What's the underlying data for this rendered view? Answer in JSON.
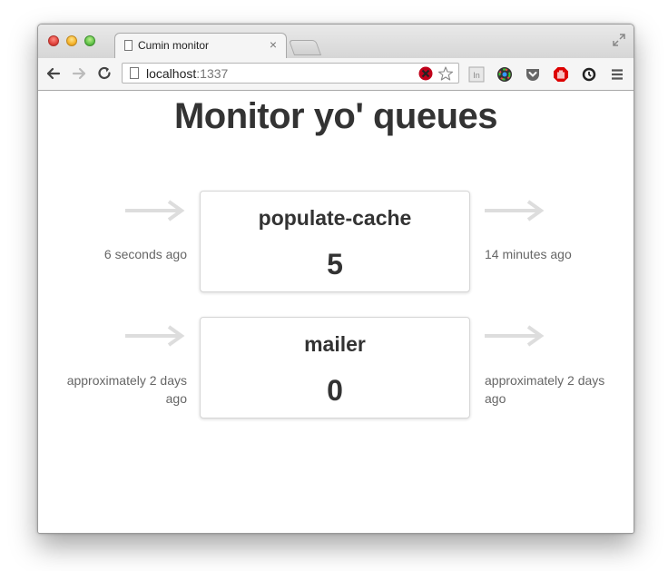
{
  "browser": {
    "tab_title": "Cumin monitor",
    "tab_close": "×",
    "url_host": "localhost",
    "url_port": ":1337",
    "extensions": [
      "lastpass-icon",
      "star-icon",
      "linkedin-icon",
      "color-picker-icon",
      "pocket-icon",
      "adblock-icon",
      "sync-icon",
      "menu-icon"
    ]
  },
  "page": {
    "title": "Monitor yo' queues"
  },
  "queues": [
    {
      "name": "populate-cache",
      "count": "5",
      "left_time": "6 seconds ago",
      "right_time": "14 minutes ago"
    },
    {
      "name": "mailer",
      "count": "0",
      "left_time": "approximately 2 days ago",
      "right_time": "approximately 2 days ago"
    }
  ]
}
